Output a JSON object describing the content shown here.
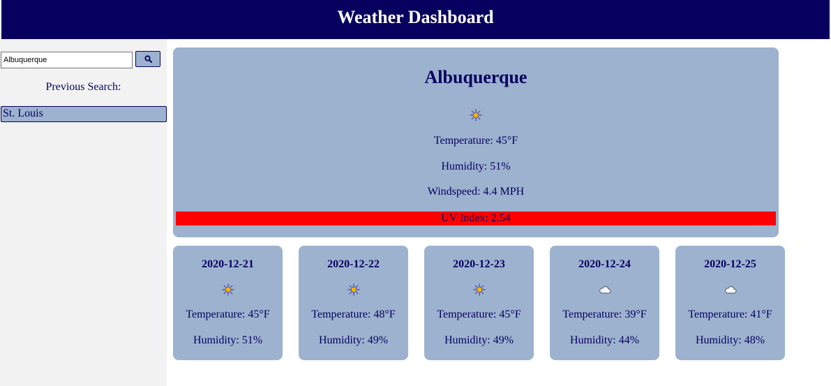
{
  "header": {
    "title": "Weather Dashboard"
  },
  "sidebar": {
    "search": {
      "value": "Albuquerque",
      "button_icon": "search-icon"
    },
    "previous_label": "Previous Search:",
    "history": [
      {
        "label": "St. Louis"
      }
    ]
  },
  "current": {
    "city": "Albuquerque",
    "icon": "sun-icon",
    "temperature": "Temperature: 45°F",
    "humidity": "Humidity: 51%",
    "windspeed": "Windspeed: 4.4 MPH",
    "uv": "UV Index: 2.54",
    "uv_color": "#ff0000"
  },
  "forecast": [
    {
      "date": "2020-12-21",
      "icon": "sun-icon",
      "temperature": "Temperature: 45°F",
      "humidity": "Humidity: 51%"
    },
    {
      "date": "2020-12-22",
      "icon": "sun-icon",
      "temperature": "Temperature: 48°F",
      "humidity": "Humidity: 49%"
    },
    {
      "date": "2020-12-23",
      "icon": "sun-icon",
      "temperature": "Temperature: 45°F",
      "humidity": "Humidity: 49%"
    },
    {
      "date": "2020-12-24",
      "icon": "cloud-icon",
      "temperature": "Temperature: 39°F",
      "humidity": "Humidity: 44%"
    },
    {
      "date": "2020-12-25",
      "icon": "cloud-icon",
      "temperature": "Temperature: 41°F",
      "humidity": "Humidity: 48%"
    }
  ],
  "colors": {
    "header_bg": "#07005e",
    "panel_bg": "#9db2cf",
    "sidebar_bg": "#f2f2f2",
    "text": "#07005e"
  }
}
